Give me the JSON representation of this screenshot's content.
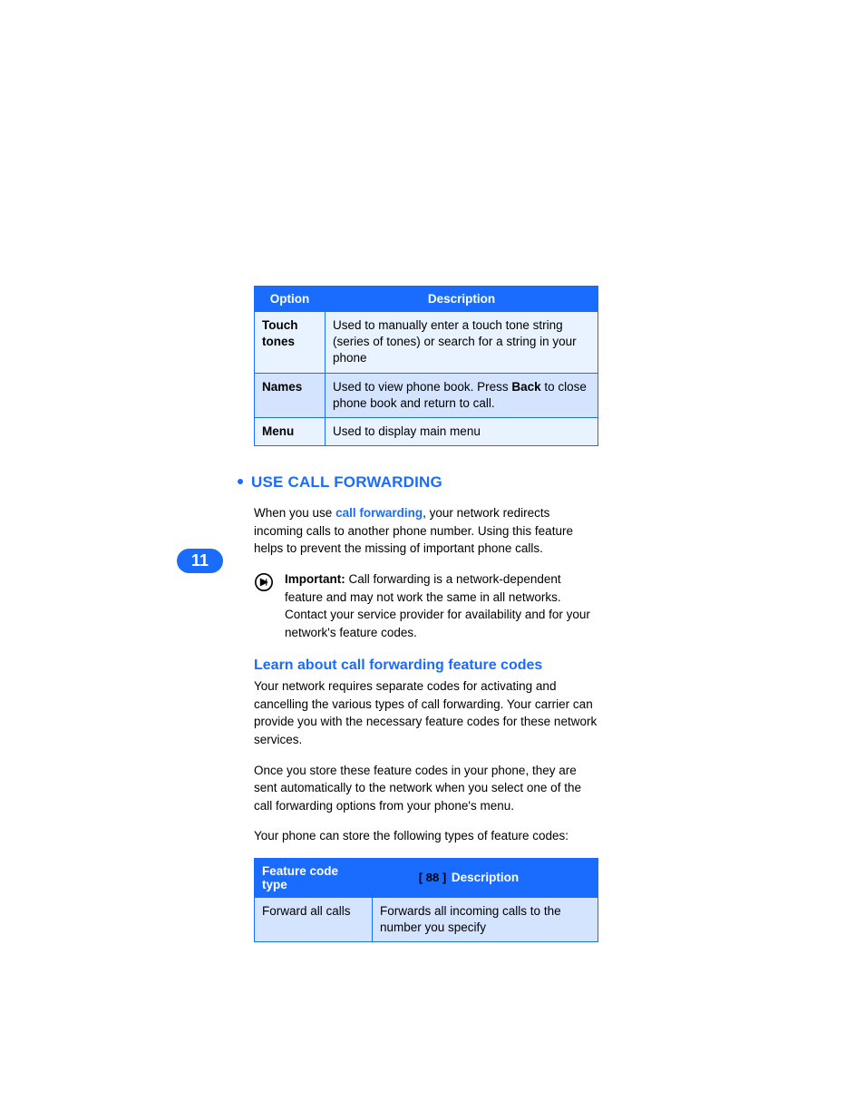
{
  "chapter_tab": "11",
  "options_table": {
    "headers": [
      "Option",
      "Description"
    ],
    "rows": [
      {
        "option": "Touch tones",
        "description": "Used to manually enter a touch tone string (series of tones) or search for a string in your phone"
      },
      {
        "option": "Names",
        "desc_pre": "Used to view phone book. Press ",
        "desc_bold": "Back",
        "desc_post": " to close phone book and return to call."
      },
      {
        "option": "Menu",
        "description": "Used to display main menu"
      }
    ]
  },
  "section": {
    "title": "USE CALL FORWARDING",
    "intro_pre": "When you use ",
    "intro_kw": "call forwarding",
    "intro_post": ", your network redirects incoming calls to another phone number. Using this feature helps to prevent the missing of important phone calls.",
    "important_label": "Important:",
    "important_body": " Call forwarding is a network-dependent feature and may not work the same in all networks. Contact your service provider for availability and for your network's feature codes.",
    "sub_heading": "Learn about call forwarding feature codes",
    "p1": "Your network requires separate codes for activating and cancelling the various types of call forwarding. Your carrier can provide you with the necessary feature codes for these network services.",
    "p2": "Once you store these feature codes in your phone, they are sent automatically to the network when you select one of the call forwarding options from your phone's menu.",
    "p3": "Your phone can store the following types of feature codes:"
  },
  "feature_table": {
    "headers": [
      "Feature code type",
      "Description"
    ],
    "rows": [
      {
        "type": "Forward all calls",
        "description": "Forwards all incoming calls to the number you specify"
      }
    ]
  },
  "page_number": "[ 88 ]"
}
